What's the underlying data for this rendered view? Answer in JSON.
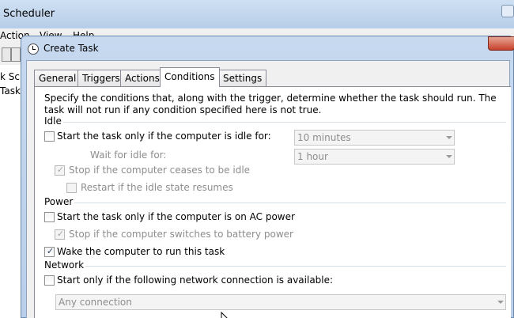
{
  "background_window": {
    "title": "Scheduler",
    "menu": [
      "Action",
      "View",
      "Help"
    ],
    "left_items": [
      "k Schel",
      "Task"
    ]
  },
  "dialog": {
    "title": "Create Task",
    "tabs": [
      {
        "label": "General",
        "active": false
      },
      {
        "label": "Triggers",
        "active": false
      },
      {
        "label": "Actions",
        "active": false
      },
      {
        "label": "Conditions",
        "active": true
      },
      {
        "label": "Settings",
        "active": false
      }
    ],
    "description": "Specify the conditions that, along with the trigger, determine whether the task should run.  The task will not run  if any condition specified here is not true.",
    "idle": {
      "group_label": "Idle",
      "start_if_idle": {
        "label": "Start the task only if the computer is idle for:",
        "checked": false,
        "enabled": true
      },
      "idle_duration": {
        "value": "10 minutes",
        "enabled": false
      },
      "wait_label": "Wait for idle for:",
      "wait_duration": {
        "value": "1 hour",
        "enabled": false
      },
      "stop_if_not_idle": {
        "label": "Stop if the computer ceases to be idle",
        "checked": true,
        "enabled": false
      },
      "restart_if_idle": {
        "label": "Restart if the idle state resumes",
        "checked": false,
        "enabled": false
      }
    },
    "power": {
      "group_label": "Power",
      "ac_power": {
        "label": "Start the task only if the computer is on AC power",
        "checked": false,
        "enabled": true
      },
      "battery_stop": {
        "label": "Stop if the computer switches to battery power",
        "checked": true,
        "enabled": false
      },
      "wake": {
        "label": "Wake the computer to run this task",
        "checked": true,
        "enabled": true
      }
    },
    "network": {
      "group_label": "Network",
      "network_condition": {
        "label": "Start only if the following network connection is available:",
        "checked": false,
        "enabled": true
      },
      "connection": {
        "value": "Any connection",
        "enabled": false
      }
    },
    "colors": {
      "checkmark": "#1e395b",
      "disabled_text": "#8d8d8d",
      "titlebar": "#c6d9ef",
      "close_button": "#c5412a"
    }
  }
}
